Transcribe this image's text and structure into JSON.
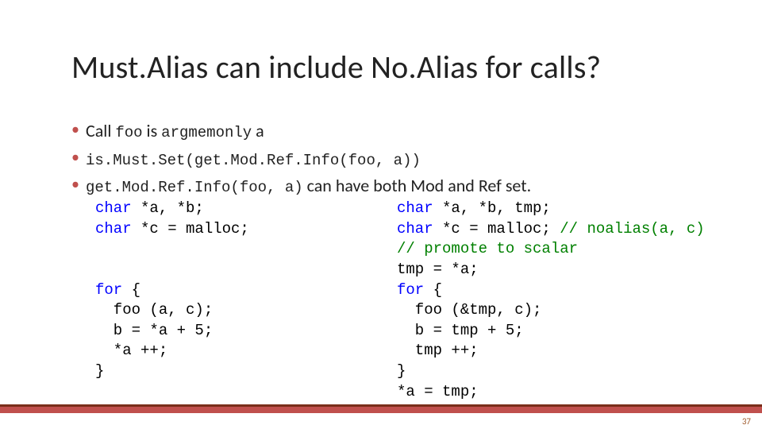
{
  "title": "Must.Alias can include No.Alias for calls?",
  "bullets": {
    "b1": {
      "prefix": "Call ",
      "code1": "foo",
      "mid": " is ",
      "code2": "argmemonly",
      "suffix": " a"
    },
    "b2_code": "is.Must.Set(get.Mod.Ref.Info(foo, a))",
    "b3": {
      "code": "get.Mod.Ref.Info(foo, a)",
      "rest": " can have both Mod and Ref set."
    }
  },
  "code_left": {
    "l1_kw": "char",
    "l1_rest": " *a, *b;",
    "l2_kw": "char",
    "l2_rest": " *c = malloc;",
    "blank1": "",
    "blank2": "",
    "l3_kw": "for",
    "l3_rest": " {",
    "l4": "  foo (a, c);",
    "l5": "  b = *a + 5;",
    "l6": "  *a ++;",
    "l7": "}"
  },
  "code_right": {
    "l1_kw": "char",
    "l1_rest": " *a, *b, tmp;",
    "l2_kw": "char",
    "l2_rest": " *c = malloc; ",
    "l2_cm": "// noalias(a, c)",
    "l3_cm": "// promote to scalar",
    "l4": "tmp = *a;",
    "l5_kw": "for",
    "l5_rest": " {",
    "l6": "  foo (&tmp, c);",
    "l7": "  b = tmp + 5;",
    "l8": "  tmp ++;",
    "l9": "}",
    "l10": "*a = tmp;"
  },
  "page_number": "37"
}
